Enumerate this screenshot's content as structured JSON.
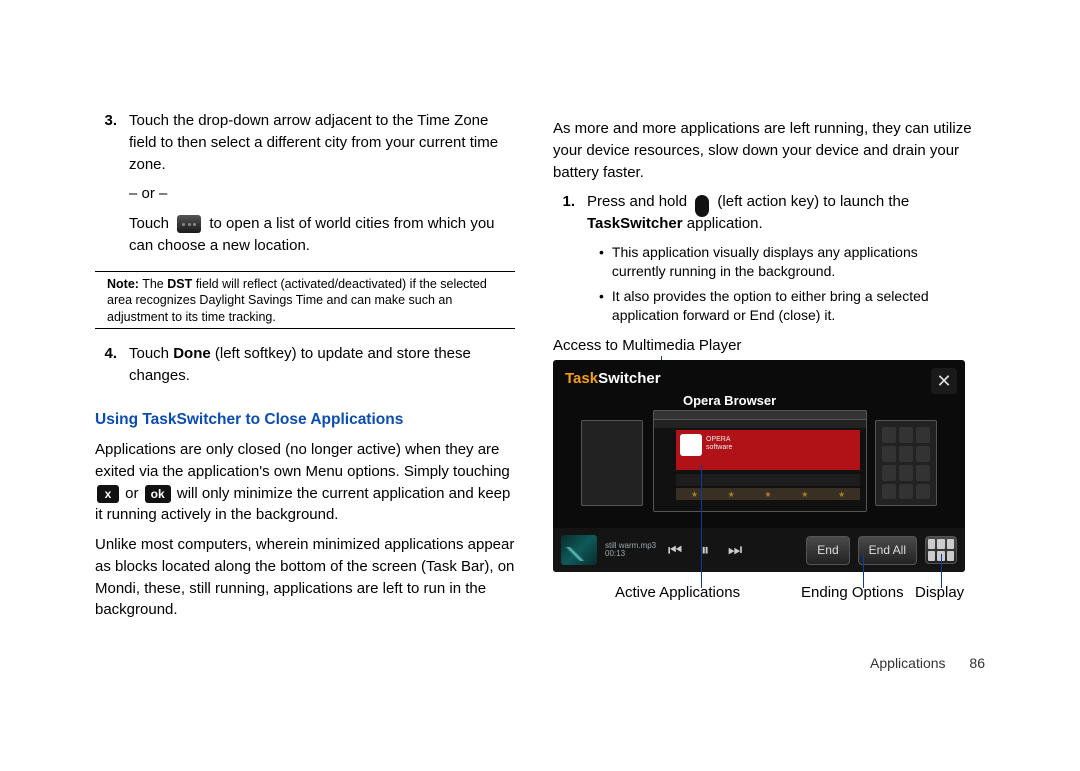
{
  "left": {
    "step3_num": "3.",
    "step3_text": "Touch the drop-down arrow adjacent to the Time Zone field to then select a different city from your current time zone.",
    "or": "– or –",
    "touch_prefix": "Touch",
    "touch_suffix": " to open a list of world cities from which you can choose a new location.",
    "note_label": "Note:",
    "note_text": " The DST field will reflect (activated/deactivated) if the selected area recognizes Daylight Savings Time and can make such an adjustment to its time tracking.",
    "note_bold": "DST",
    "step4_num": "4.",
    "step4_a": "Touch ",
    "step4_done": "Done",
    "step4_b": " (left softkey) to update and store these changes.",
    "heading": "Using TaskSwitcher to Close Applications",
    "para1_a": "Applications are only closed (no longer active) when they are exited via the application's own Menu options. Simply touching ",
    "para1_b": " or ",
    "para1_c": " will only minimize the current application and keep it running actively in the background.",
    "x_label": "x",
    "ok_label": "ok",
    "para2": "Unlike most computers, wherein minimized applications appear as blocks located along the bottom of the screen (Task Bar), on Mondi, these, still running, applications are left to run in the background."
  },
  "right": {
    "para1": "As more and more applications are left running, they can utilize your device resources, slow down your device and drain your battery faster.",
    "step1_num": "1.",
    "step1_a": "Press and hold ",
    "step1_b": " (left action key) to launch the ",
    "step1_app": "TaskSwitcher",
    "step1_c": " application.",
    "bullet1": "This application visually displays any applications currently running in the background.",
    "bullet2": "It also provides the option to either bring a selected application forward or End (close) it.",
    "caption_top": "Access to Multimedia Player",
    "shot": {
      "title_a": "Task",
      "title_b": "Switcher",
      "close": "✕",
      "app_label": "Opera Browser",
      "opera_line1": "OPERA",
      "opera_line2": "software",
      "track": "still warm.mp3",
      "time": "00:13",
      "end": "End",
      "end_all": "End All",
      "prev": "⏮",
      "pause": "⏸",
      "next": "⏭",
      "star": "★"
    },
    "label_active": "Active Applications",
    "label_ending": "Ending Options",
    "label_display": "Display"
  },
  "footer": {
    "section": "Applications",
    "page": "86"
  }
}
